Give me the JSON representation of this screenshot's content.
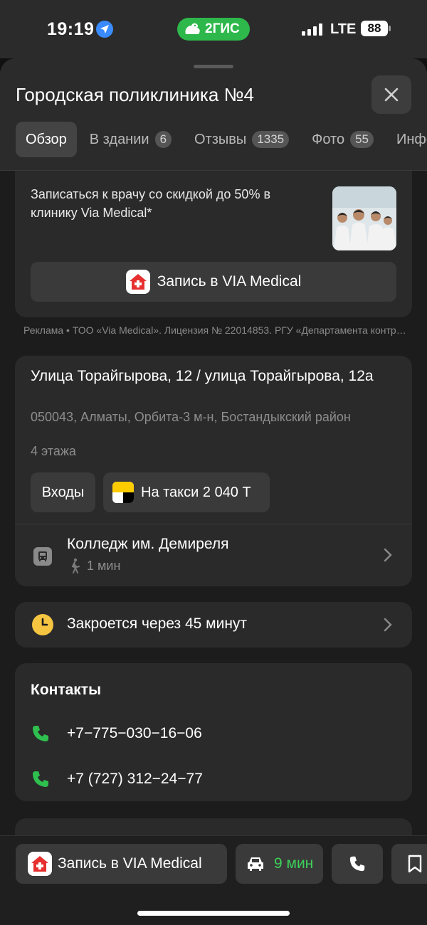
{
  "status_bar": {
    "time": "19:19",
    "app_badge": "2ГИС",
    "network": "LTE",
    "battery": "88"
  },
  "header": {
    "title": "Городская поликлиника №4",
    "close_icon": "close-icon"
  },
  "tabs": [
    {
      "label": "Обзор",
      "count": null,
      "active": true
    },
    {
      "label": "В здании",
      "count": "6"
    },
    {
      "label": "Отзывы",
      "count": "1335"
    },
    {
      "label": "Фото",
      "count": "55"
    },
    {
      "label": "Инфо",
      "count": null
    }
  ],
  "ad": {
    "text": "Записаться к врачу со скидкой до 50% в клинику Via Medical*",
    "button_label": "Запись в VIA Medical",
    "disclaimer": "Реклама • ТОО «Via Medical». Лицензия № 22014853. РГУ «Департамента контроля»"
  },
  "address": {
    "street": "Улица Торайгырова, 12 / улица Торайгырова, 12а",
    "details": "050043, Алматы, Орбита-3 м-н, Бостандыкский район",
    "floors": "4 этажа",
    "entrances_label": "Входы",
    "taxi_label": "На такси 2 040 Т",
    "stop_name": "Колледж им. Демиреля",
    "walk_time": "1 мин"
  },
  "hours": {
    "text": "Закроется через 45 минут"
  },
  "contacts": {
    "title": "Контакты",
    "phones": [
      "+7−775−030−16−06",
      "+7 (727) 312−24−77"
    ]
  },
  "bottom_bar": {
    "record_label": "Запись в VIA Medical",
    "route_eta": "9 мин"
  },
  "colors": {
    "background": "#1c1c1c",
    "card": "#2a2a2a",
    "accent_green": "#3dd15a",
    "brand_2gis": "#2eb84b",
    "clock_yellow": "#f5c542"
  }
}
